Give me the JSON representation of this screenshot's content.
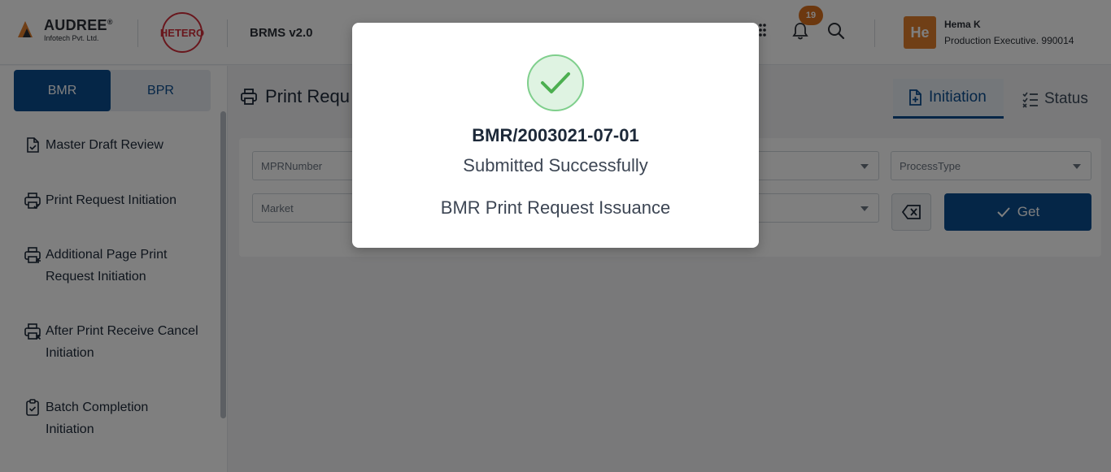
{
  "header": {
    "company_name": "AUDREE",
    "company_reg": "®",
    "company_sub": "Infotech Pvt. Ltd.",
    "partner_logo": "HETERO",
    "app_title": "BRMS v2.0",
    "notification_count": "19",
    "user": {
      "avatar_initials": "He",
      "name": "Hema K",
      "role": "Production Executive. 990014"
    }
  },
  "sidebar": {
    "segments": [
      {
        "label": "BMR",
        "active": true
      },
      {
        "label": "BPR",
        "active": false
      }
    ],
    "items": [
      {
        "label": "Master Draft Review",
        "icon": "document-check-icon"
      },
      {
        "label": "Print Request Initiation",
        "icon": "printer-check-icon"
      },
      {
        "label": "Additional Page Print Request Initiation",
        "icon": "printer-plus-icon"
      },
      {
        "label": "After Print Receive Cancel Initiation",
        "icon": "printer-x-icon"
      },
      {
        "label": "Batch Completion Initiation",
        "icon": "clipboard-check-icon"
      }
    ]
  },
  "main": {
    "page_title": "Print Requ",
    "tabs": [
      {
        "label": "Initiation",
        "active": true
      },
      {
        "label": "Status",
        "active": false
      }
    ],
    "filters": {
      "mpr_number_placeholder": "MPRNumber",
      "process_type_placeholder": "ProcessType",
      "market_placeholder": "Market",
      "get_label": "Get"
    }
  },
  "modal": {
    "record_id": "BMR/2003021-07-01",
    "message": "Submitted Successfully",
    "sub_message": "BMR Print Request Issuance"
  },
  "colors": {
    "primary": "#0b4c8f",
    "brand_orange": "#e07f2d",
    "success_green": "#4caf50",
    "hetero_red": "#d32f3a"
  }
}
